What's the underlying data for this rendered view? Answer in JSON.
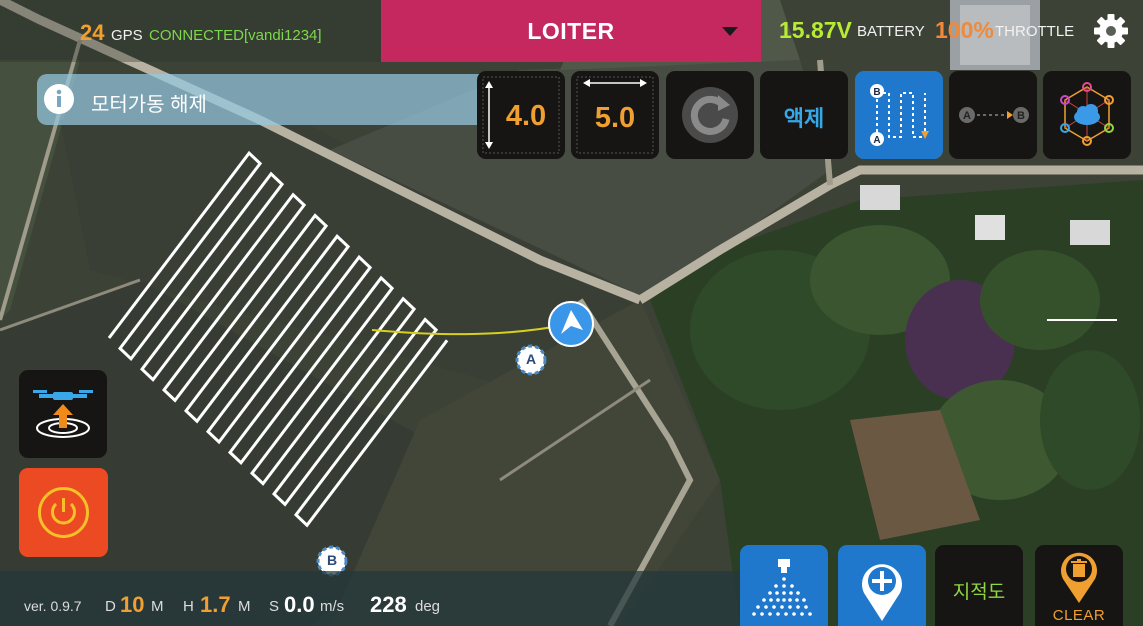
{
  "header": {
    "gps_count": "24",
    "gps_label": "GPS",
    "connection_status": "CONNECTED[vandi1234]",
    "flight_mode": "LOITER",
    "battery_voltage": "15.87V",
    "battery_label": "BATTERY",
    "throttle_value": "100%",
    "throttle_label": "THROTTLE"
  },
  "info": {
    "message": "모터가동 해제"
  },
  "toolbar": {
    "height_value": "4.0",
    "width_value": "5.0",
    "spray_label": "액제"
  },
  "statusbar": {
    "version": "ver. 0.9.7",
    "distance_label": "D",
    "distance_value": "10",
    "distance_unit": "M",
    "height_label": "H",
    "height_value": "1.7",
    "height_unit": "M",
    "speed_label": "S",
    "speed_value": "0.0",
    "speed_unit": "m/s",
    "heading_value": "228",
    "heading_unit": "deg"
  },
  "bottom_buttons": {
    "map_label": "지적도",
    "clear_label": "CLEAR"
  },
  "map": {
    "marker_a": "A",
    "marker_b": "B"
  },
  "icons": {
    "settings": "gear-icon",
    "info": "info-icon",
    "refresh": "refresh-icon",
    "zigzag_route": "zigzag-route-icon",
    "ab_route": "ab-route-icon",
    "cloud_network": "cloud-network-icon",
    "takeoff": "drone-takeoff-icon",
    "power": "power-icon",
    "spray": "spray-icon",
    "add_waypoint": "add-waypoint-icon",
    "clear": "trash-pin-icon"
  },
  "colors": {
    "mode_bar": "#c4285e",
    "accent_orange": "#f0a030",
    "battery_green": "#b8ec34",
    "connected_green": "#7cd84c",
    "active_blue": "#1f78cc",
    "power_red": "#ec4a22"
  }
}
